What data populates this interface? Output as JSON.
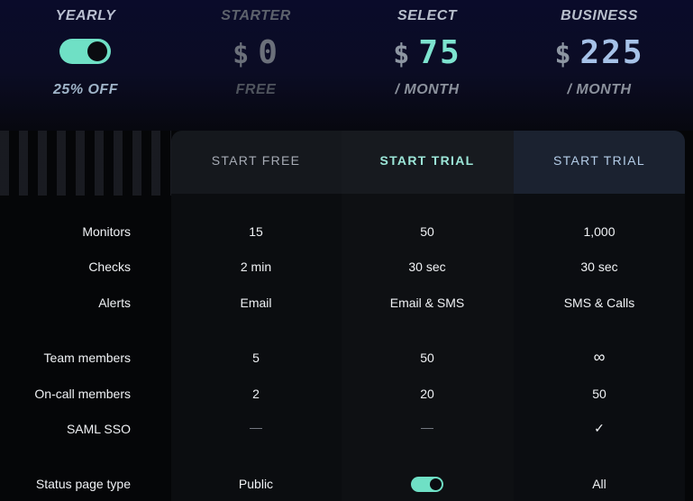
{
  "billing": {
    "period_label": "YEARLY",
    "discount": "25% OFF",
    "toggle_on": true
  },
  "plans": [
    {
      "name": "STARTER",
      "currency": "$",
      "amount": "0",
      "period": "FREE",
      "cta": "START FREE"
    },
    {
      "name": "SELECT",
      "currency": "$",
      "amount": "75",
      "period": "/ MONTH",
      "cta": "START TRIAL"
    },
    {
      "name": "BUSINESS",
      "currency": "$",
      "amount": "225",
      "period": "/ MONTH",
      "cta": "START TRIAL"
    }
  ],
  "rows": [
    {
      "label": "Monitors",
      "values": [
        "15",
        "50",
        "1,000"
      ]
    },
    {
      "label": "Checks",
      "values": [
        "2 min",
        "30 sec",
        "30 sec"
      ]
    },
    {
      "label": "Alerts",
      "values": [
        "Email",
        "Email & SMS",
        "SMS & Calls"
      ]
    },
    {
      "label": "Team members",
      "values": [
        "5",
        "50",
        "∞"
      ]
    },
    {
      "label": "On-call members",
      "values": [
        "2",
        "20",
        "50"
      ]
    },
    {
      "label": "SAML SSO",
      "values": [
        "—",
        "—",
        "✓"
      ]
    },
    {
      "label": "Status page type",
      "values": [
        "Public",
        "",
        "All"
      ]
    }
  ],
  "colors": {
    "accent_mint": "#6fe0c5",
    "starter_dim": "#5d626c",
    "select_mint": "#7de3cf",
    "business_blue": "#a6c2e8"
  }
}
